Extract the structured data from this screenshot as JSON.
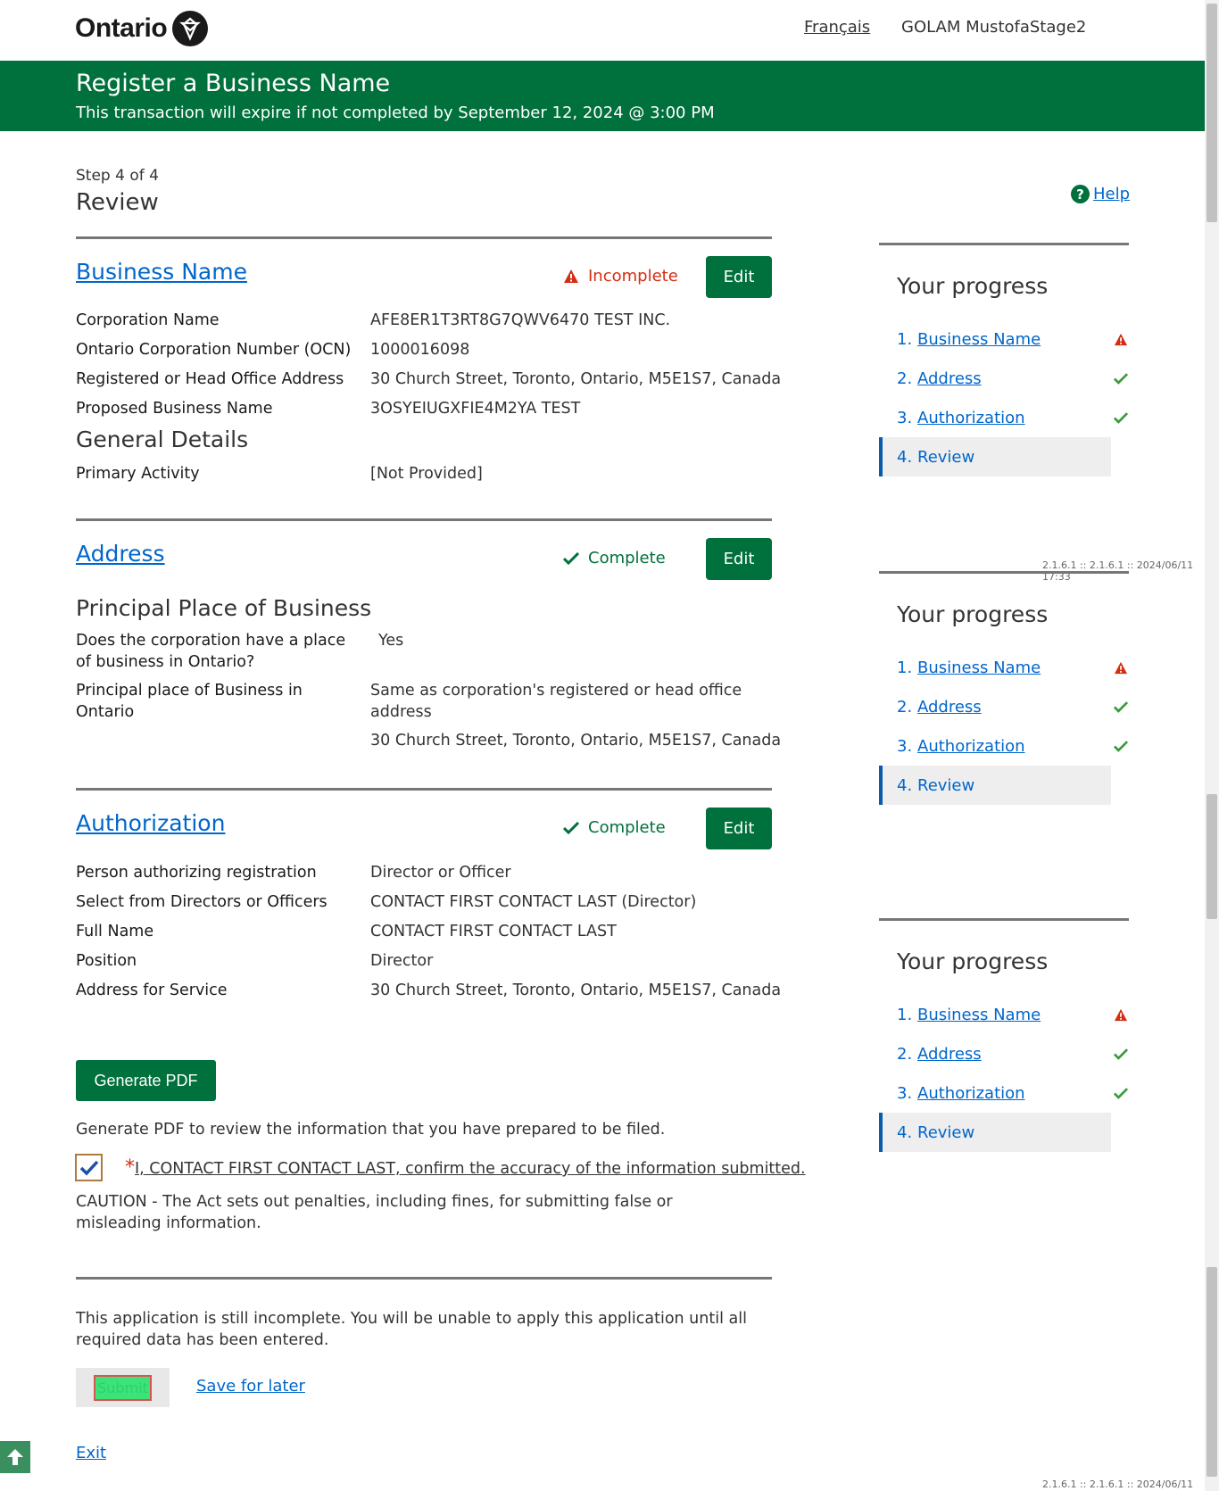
{
  "header": {
    "logo_text": "Ontario",
    "language_link": "Français",
    "user_name": "GOLAM MustofaStage2"
  },
  "banner": {
    "title": "Register a Business Name",
    "subtitle": "This transaction will expire if not completed by September 12, 2024 @ 3:00 PM"
  },
  "page": {
    "step": "Step 4 of 4",
    "title": "Review",
    "help_label": "Help"
  },
  "business_name": {
    "title": "Business Name",
    "status": "Incomplete",
    "edit_label": "Edit",
    "fields": [
      {
        "label": "Corporation Name",
        "value": "AFE8ER1T3RT8G7QWV6470 TEST INC."
      },
      {
        "label": "Ontario Corporation Number (OCN)",
        "value": "1000016098"
      },
      {
        "label": "Registered or Head Office Address",
        "value": "30 Church Street, Toronto, Ontario, M5E1S7, Canada"
      },
      {
        "label": "Proposed Business Name",
        "value": "3OSYEIUGXFIE4M2YA TEST"
      }
    ],
    "general_details_heading": "General Details",
    "primary_activity_label": "Primary Activity",
    "primary_activity_value": "[Not Provided]"
  },
  "address": {
    "title": "Address",
    "status": "Complete",
    "edit_label": "Edit",
    "subheading": "Principal Place of Business",
    "q1_label": "Does the corporation have a place of business in Ontario?",
    "q1_value": "Yes",
    "q2_label": "Principal place of Business in Ontario",
    "q2_value": "Same as corporation's registered or head office address",
    "q2_address": "30 Church Street, Toronto, Ontario, M5E1S7, Canada"
  },
  "authorization": {
    "title": "Authorization",
    "status": "Complete",
    "edit_label": "Edit",
    "fields": [
      {
        "label": "Person authorizing registration",
        "value": "Director or Officer"
      },
      {
        "label": "Select from Directors or Officers",
        "value": "CONTACT FIRST CONTACT LAST (Director)"
      },
      {
        "label": "Full Name",
        "value": "CONTACT FIRST CONTACT LAST"
      },
      {
        "label": "Position",
        "value": "Director"
      },
      {
        "label": "Address for Service",
        "value": "30 Church Street, Toronto, Ontario, M5E1S7, Canada"
      }
    ]
  },
  "footer_actions": {
    "generate_pdf_label": "Generate PDF",
    "pdf_note": "Generate PDF to review the information that you have prepared to be filed.",
    "confirm_required_mark": "*",
    "confirm_text": "I, CONTACT FIRST CONTACT LAST, confirm the accuracy of the information submitted.",
    "confirm_checked": true,
    "caution": "CAUTION - The Act sets out penalties, including fines, for submitting false or misleading information.",
    "incomplete_note": "This application is still incomplete. You will be unable to apply this application until all required data has been entered.",
    "submit_label": "Submit",
    "save_later_label": "Save for later",
    "exit_label": "Exit"
  },
  "progress": {
    "title": "Your progress",
    "items": [
      {
        "num": "1.",
        "label": "Business Name",
        "status": "incomplete"
      },
      {
        "num": "2.",
        "label": "Address",
        "status": "complete"
      },
      {
        "num": "3.",
        "label": "Authorization",
        "status": "complete"
      },
      {
        "num": "4.",
        "label": "Review",
        "status": "current"
      }
    ]
  },
  "version_text": "2.1.6.1 :: 2.1.6.1 :: 2024/06/11 17:33",
  "colors": {
    "brand_green": "#00703c",
    "link_blue": "#0066cc",
    "error_red": "#d42e12",
    "check_green": "#3a9a3a"
  },
  "icons": {
    "warning": "warning-triangle-icon",
    "check": "checkmark-icon",
    "help": "question-circle-icon",
    "back_to_top": "arrow-up-icon",
    "ontario_logo": "trillium-logo-icon"
  }
}
